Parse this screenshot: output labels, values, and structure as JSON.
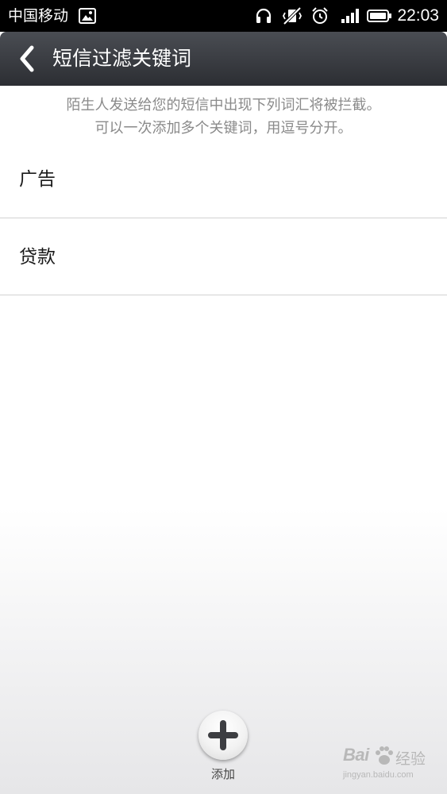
{
  "status_bar": {
    "carrier": "中国移动",
    "time": "22:03",
    "icons": [
      "image-icon",
      "headset-icon",
      "vibrate-off-icon",
      "alarm-icon",
      "signal-icon",
      "battery-icon"
    ]
  },
  "header": {
    "back_icon": "chevron-left-icon",
    "title": "短信过滤关键词"
  },
  "description": {
    "line1": "陌生人发送给您的短信中出现下列词汇将被拦截。",
    "line2": "可以一次添加多个关键词，用逗号分开。"
  },
  "keywords": [
    {
      "label": "广告"
    },
    {
      "label": "贷款"
    }
  ],
  "bottom_bar": {
    "add_icon": "plus-icon",
    "add_label": "添加"
  },
  "watermark": {
    "brand": "Bai",
    "brand_suffix": "经验",
    "url": "jingyan.baidu.com"
  },
  "colors": {
    "header_bg": "#35373c",
    "status_bg": "#000000",
    "description_text": "#8a8a8a",
    "divider": "#d2d2d2"
  }
}
